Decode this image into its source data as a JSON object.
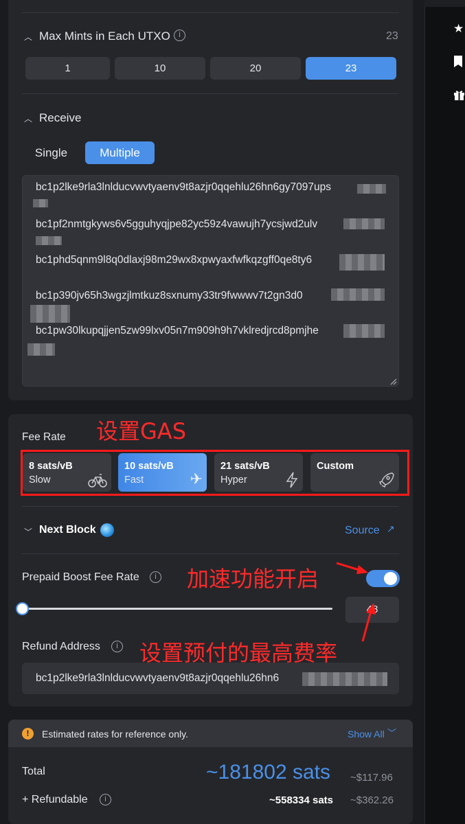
{
  "mints": {
    "title": "Max Mints in Each UTXO",
    "value": "23",
    "options": [
      "1",
      "10",
      "20",
      "23"
    ]
  },
  "receive": {
    "title": "Receive",
    "tab_single": "Single",
    "tab_multiple": "Multiple",
    "addresses": [
      "bc1p2lke9rla3lnlducvwvtyaenv9t8azjr0qqehlu26hn6gy7097ups",
      "bc1pf2nmtgkyws6v5gguhyqjpe82yc59z4vawujh7ycsjwd2ulv",
      "bc1phd5qnm9l8q0dlaxj98m29wx8xpwyaxfwfkqzgff0qe8ty6",
      "bc1p390jv65h3wgzjlmtkuz8sxnumy33tr9fwwwv7t2gn3d0",
      "bc1pw30lkupqjjen5zw99lxv05n7m909h9h7vklredjrcd8pmjhe"
    ]
  },
  "fee": {
    "title": "Fee Rate",
    "options": [
      {
        "rate": "8 sats/vB",
        "speed": "Slow",
        "icon": "bicycle-icon"
      },
      {
        "rate": "10 sats/vB",
        "speed": "Fast",
        "icon": "airplane-icon"
      },
      {
        "rate": "21 sats/vB",
        "speed": "Hyper",
        "icon": "lightning-icon"
      },
      {
        "rate": "Custom",
        "speed": "",
        "icon": "rocket-icon"
      }
    ],
    "annotation": "设置GAS"
  },
  "next_block": {
    "title": "Next Block",
    "source_label": "Source"
  },
  "prepaid": {
    "title": "Prepaid Boost Fee Rate",
    "enabled": true,
    "slider_value": "48",
    "annotation_toggle": "加速功能开启",
    "annotation_value": "设置预付的最高费率"
  },
  "refund": {
    "title": "Refund Address",
    "value": "bc1p2lke9rla3lnlducvwvtyaenv9t8azjr0qqehlu26hn6"
  },
  "estimate": {
    "notice": "Estimated rates for reference only.",
    "show_all": "Show All",
    "total_label": "Total",
    "total_value": "~181802 sats",
    "total_usd": "~$117.96",
    "refundable_label": "+ Refundable",
    "refundable_value": "~558334 sats",
    "refundable_usd": "~$362.26"
  },
  "colors": {
    "accent": "#4a90e8",
    "annotation": "#ff2a2a",
    "warning": "#f0a030"
  }
}
